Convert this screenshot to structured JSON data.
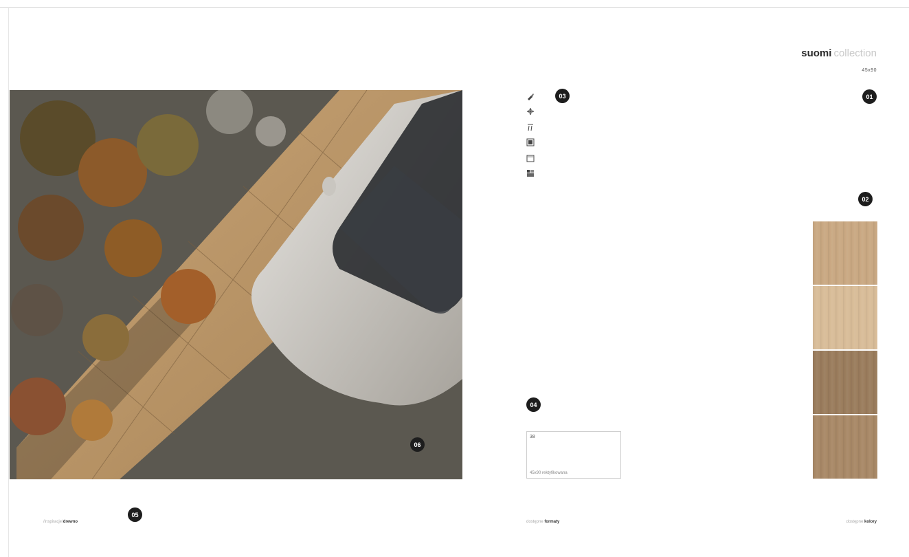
{
  "collection": {
    "name": "suomi",
    "word": "collection",
    "size": "45x90"
  },
  "badges": {
    "b01": "01",
    "b02": "02",
    "b03": "03",
    "b04": "04",
    "b05": "05",
    "b06": "06"
  },
  "icons": [
    "brush-icon",
    "frost-icon",
    "rectified-icon",
    "tile-icon",
    "surface-icon",
    "pattern-icon"
  ],
  "format": {
    "thickness": "38",
    "description": "45x90 rektyfikowana"
  },
  "footer": {
    "left_prefix": "/inspiracje/",
    "left_bold": "drewno",
    "mid_prefix": "dostępne ",
    "mid_bold": "formaty",
    "right_prefix": "dostępne ",
    "right_bold": "kolory"
  },
  "tile_colors": [
    "#c9a882",
    "#d8bc98",
    "#9a7c5c",
    "#a88866"
  ]
}
